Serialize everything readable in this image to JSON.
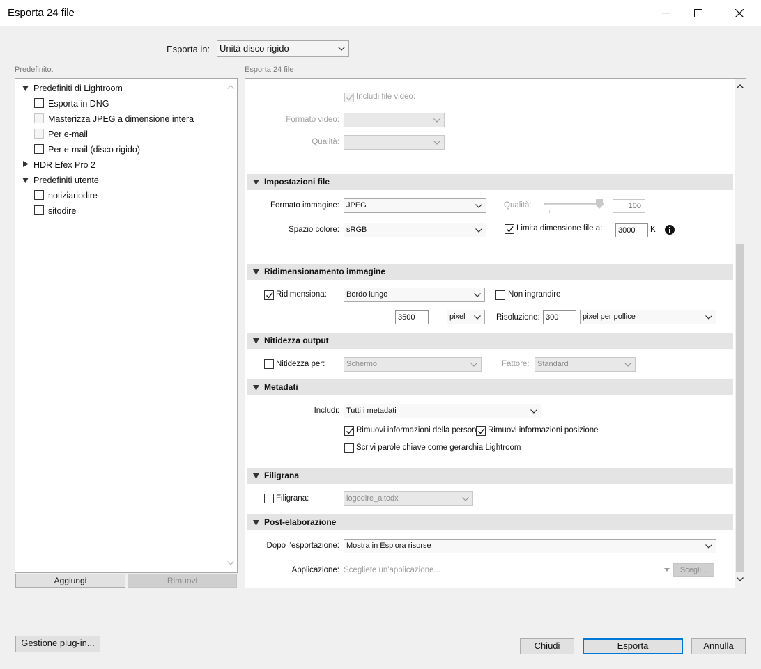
{
  "window": {
    "title": "Esporta 24 file"
  },
  "export_to": {
    "label": "Esporta in:",
    "value": "Unità disco rigido"
  },
  "presets": {
    "heading": "Predefinito:",
    "groups": [
      {
        "label": "Predefiniti di Lightroom",
        "items": [
          "Esporta in DNG",
          "Masterizza JPEG a dimensione intera",
          "Per e-mail",
          "Per e-mail (disco rigido)"
        ]
      },
      {
        "label": "HDR Efex Pro 2"
      },
      {
        "label": "Predefiniti utente",
        "items": [
          "notiziariodire",
          "sitodire"
        ]
      }
    ],
    "add_button": "Aggiungi",
    "remove_button": "Rimuovi"
  },
  "export_panel": {
    "heading": "Esporta 24 file"
  },
  "video": {
    "include_label": "Includi file video:",
    "format_label": "Formato video:",
    "quality_label": "Qualità:"
  },
  "file_settings": {
    "title": "Impostazioni file",
    "format_label": "Formato immagine:",
    "format_value": "JPEG",
    "quality_label": "Qualità:",
    "quality_value": "100",
    "colorspace_label": "Spazio colore:",
    "colorspace_value": "sRGB",
    "limit_label": "Limita dimensione file a:",
    "limit_value": "3000",
    "limit_unit": "K"
  },
  "resize": {
    "title": "Ridimensionamento immagine",
    "resize_label": "Ridimensiona:",
    "resize_value": "Bordo lungo",
    "no_enlarge_label": "Non ingrandire",
    "size_value": "3500",
    "size_unit": "pixel",
    "resolution_label": "Risoluzione:",
    "resolution_value": "300",
    "resolution_unit": "pixel per pollice"
  },
  "sharpening": {
    "title": "Nitidezza output",
    "sharpen_label": "Nitidezza per:",
    "sharpen_value": "Schermo",
    "amount_label": "Fattore:",
    "amount_value": "Standard"
  },
  "metadata": {
    "title": "Metadati",
    "include_label": "Includi:",
    "include_value": "Tutti i metadati",
    "remove_person_label": "Rimuovi informazioni della persona",
    "remove_location_label": "Rimuovi informazioni posizione",
    "keywords_label": "Scrivi parole chiave come gerarchia Lightroom"
  },
  "watermark": {
    "title": "Filigrana",
    "label": "Filigrana:",
    "value": "logodire_altodx"
  },
  "post_processing": {
    "title": "Post-elaborazione",
    "after_label": "Dopo l'esportazione:",
    "after_value": "Mostra in Esplora risorse",
    "app_label": "Applicazione:",
    "app_placeholder": "Scegliete un'applicazione...",
    "choose_button": "Scegli..."
  },
  "footer": {
    "plugin_button": "Gestione plug-in...",
    "close_button": "Chiudi",
    "export_button": "Esporta",
    "cancel_button": "Annulla"
  },
  "colors": {
    "accent": "#0078d7",
    "section_bg": "#e4e4e4",
    "dialog_bg": "#f0f0f0"
  }
}
